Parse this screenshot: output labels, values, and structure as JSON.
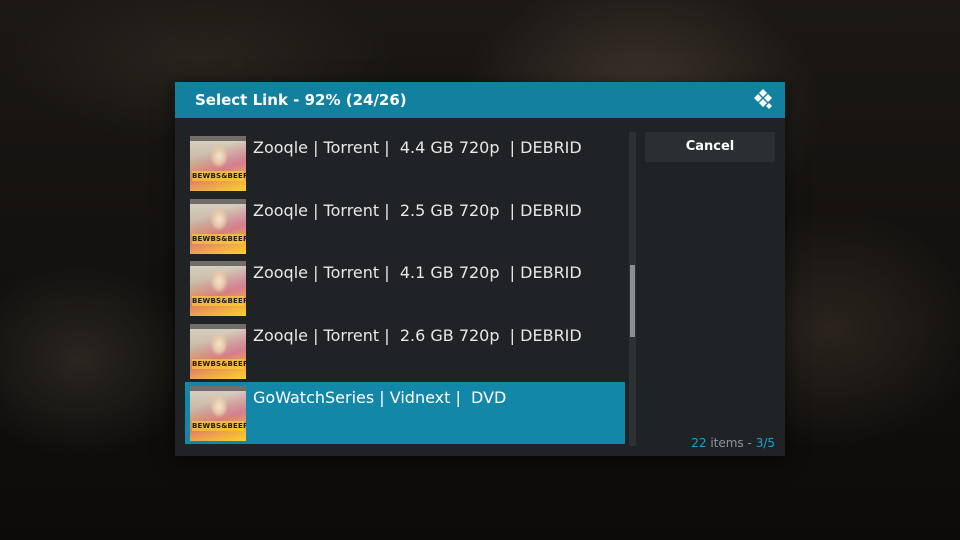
{
  "dialog": {
    "title": "Select Link - 92% (24/26)",
    "logo_icon": "kodi-logo-icon",
    "cancel_label": "Cancel"
  },
  "list": {
    "thumbnail_caption": "BEWBS&BEER",
    "items": [
      {
        "label": "Zooqle | Torrent |  4.4 GB 720p  | DEBRID",
        "selected": false
      },
      {
        "label": "Zooqle | Torrent |  2.5 GB 720p  | DEBRID",
        "selected": false
      },
      {
        "label": "Zooqle | Torrent |  4.1 GB 720p  | DEBRID",
        "selected": false
      },
      {
        "label": "Zooqle | Torrent |  2.6 GB 720p  | DEBRID",
        "selected": false
      },
      {
        "label": "GoWatchSeries | Vidnext |  DVD",
        "selected": true
      }
    ]
  },
  "scroll": {
    "position_fraction": 0.55,
    "visible_fraction": 0.23
  },
  "footer": {
    "item_count": "22",
    "items_word": "items",
    "separator": "-",
    "page": "3/5"
  },
  "colors": {
    "accent": "#12809f",
    "selected_row": "#1387a8",
    "dialog_bg": "#1f2325",
    "count_highlight": "#13a4d2"
  }
}
